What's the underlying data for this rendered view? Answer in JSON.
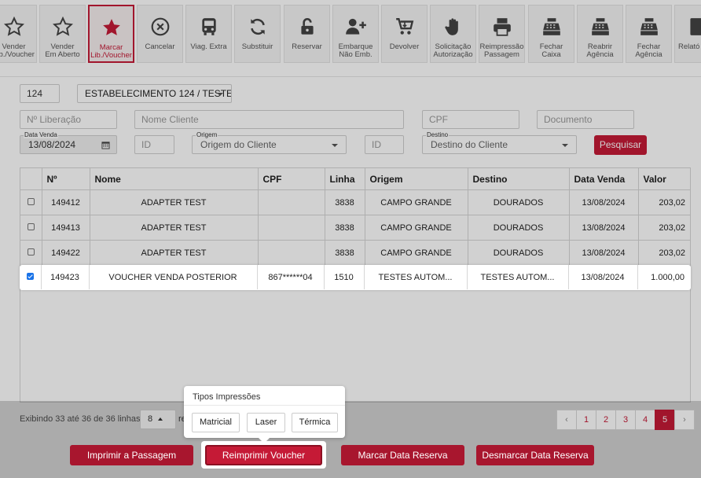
{
  "toolbar": {
    "buttons": [
      {
        "label": "Vender\nLib./Voucher",
        "icon": "star-outline-icon"
      },
      {
        "label": "Vender\nEm Aberto",
        "icon": "star-outline-icon"
      },
      {
        "label": "Marcar\nLib./Voucher",
        "icon": "star-filled-icon"
      },
      {
        "label": "Cancelar",
        "icon": "circle-x-icon"
      },
      {
        "label": "Viag. Extra",
        "icon": "bus-icon"
      },
      {
        "label": "Substituir",
        "icon": "refresh-icon"
      },
      {
        "label": "Reservar",
        "icon": "unlock-icon"
      },
      {
        "label": "Embarque\nNão Emb.",
        "icon": "user-plus-icon"
      },
      {
        "label": "Devolver",
        "icon": "cart-icon"
      },
      {
        "label": "Solicitação\nAutorização",
        "icon": "hand-icon"
      },
      {
        "label": "Reimpressão\nPassagem",
        "icon": "printer-icon"
      },
      {
        "label": "Fechar\nCaixa",
        "icon": "cash-register-icon"
      },
      {
        "label": "Reabrir\nAgência",
        "icon": "cash-register-icon"
      },
      {
        "label": "Fechar\nAgência",
        "icon": "cash-register-icon"
      },
      {
        "label": "Relató",
        "icon": "document-icon"
      }
    ]
  },
  "form": {
    "agency_code": "124",
    "establishment": "ESTABELECIMENTO 124 / TESTE",
    "liberacao_placeholder": "Nº Liberação",
    "cliente_placeholder": "Nome Cliente",
    "cpf_placeholder": "CPF",
    "documento_placeholder": "Documento",
    "data_venda_label": "Data Venda",
    "data_venda": "13/08/2024",
    "origem_id_placeholder": "ID",
    "origem_label": "Origem",
    "origem_placeholder": "Origem do Cliente",
    "destino_id_placeholder": "ID",
    "destino_label": "Destino",
    "destino_placeholder": "Destino do Cliente",
    "search_label": "Pesquisar"
  },
  "table": {
    "headers": [
      "",
      "Nº",
      "Nome",
      "CPF",
      "Linha",
      "Origem",
      "Destino",
      "Data Venda",
      "Valor"
    ],
    "rows": [
      {
        "checked": false,
        "num": "149412",
        "nome": "ADAPTER TEST",
        "cpf": "",
        "linha": "3838",
        "origem": "CAMPO GRANDE",
        "destino": "DOURADOS",
        "data": "13/08/2024",
        "valor": "203,02"
      },
      {
        "checked": false,
        "num": "149413",
        "nome": "ADAPTER TEST",
        "cpf": "",
        "linha": "3838",
        "origem": "CAMPO GRANDE",
        "destino": "DOURADOS",
        "data": "13/08/2024",
        "valor": "203,02"
      },
      {
        "checked": false,
        "num": "149422",
        "nome": "ADAPTER TEST",
        "cpf": "",
        "linha": "3838",
        "origem": "CAMPO GRANDE",
        "destino": "DOURADOS",
        "data": "13/08/2024",
        "valor": "203,02"
      },
      {
        "checked": true,
        "num": "149423",
        "nome": "VOUCHER VENDA POSTERIOR",
        "cpf": "867******04",
        "linha": "1510",
        "origem": "TESTES AUTOM...",
        "destino": "TESTES AUTOM...",
        "data": "13/08/2024",
        "valor": "1.000,00"
      }
    ]
  },
  "footer": {
    "showing": "Exibindo 33 até 36 de 36 linhas",
    "page_size": "8",
    "page_size_suffix": "re",
    "pages": [
      "‹",
      "1",
      "2",
      "3",
      "4",
      "5",
      "›"
    ],
    "current_page": "5"
  },
  "popover": {
    "title": "Tipos Impressões",
    "options": [
      "Matricial",
      "Laser",
      "Térmica"
    ]
  },
  "actions": {
    "imprimir": "Imprimir a Passagem",
    "reimprimir": "Reimprimir Voucher",
    "marcar": "Marcar Data Reserva",
    "desmarcar": "Desmarcar Data Reserva"
  },
  "colors": {
    "accent": "#c51a36",
    "checkbox": "#1a73e8"
  }
}
